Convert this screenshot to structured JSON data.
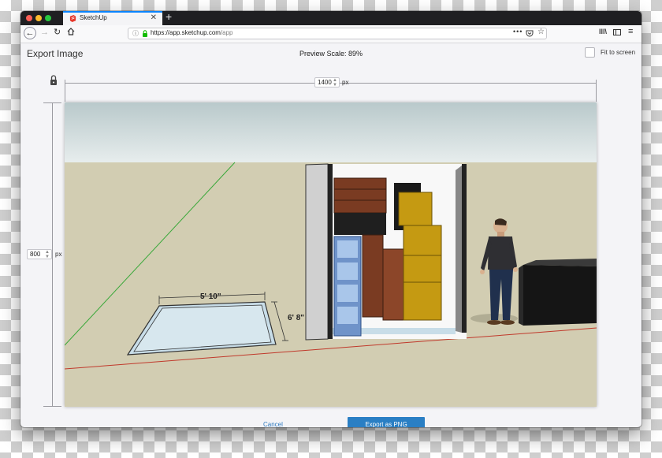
{
  "browser": {
    "tab_title": "SketchUp",
    "new_tab_glyph": "+",
    "url_host": "https://app.sketchup.com",
    "url_path": "/app",
    "icons": [
      "back-arrow-icon",
      "forward-arrow-icon",
      "reload-icon",
      "home-icon",
      "info-icon",
      "lock-icon",
      "more-icon",
      "pocket-icon",
      "star-icon",
      "library-icon",
      "sidebar-icon",
      "menu-icon",
      "close-icon"
    ]
  },
  "dialog": {
    "title": "Export Image",
    "preview_scale": "Preview Scale: 89%",
    "fit_to_screen_label": "Fit to screen",
    "width_value": "1400",
    "height_value": "800",
    "unit": "px",
    "cancel_label": "Cancel",
    "export_label": "Export as PNG"
  },
  "scene": {
    "dimension_width": "5' 10\"",
    "dimension_depth": "6' 8\""
  },
  "colors": {
    "accent": "#2a7fc4",
    "link": "#2f7bbf",
    "ground": "#d2cdb2",
    "sky": "#c9d6d7"
  }
}
